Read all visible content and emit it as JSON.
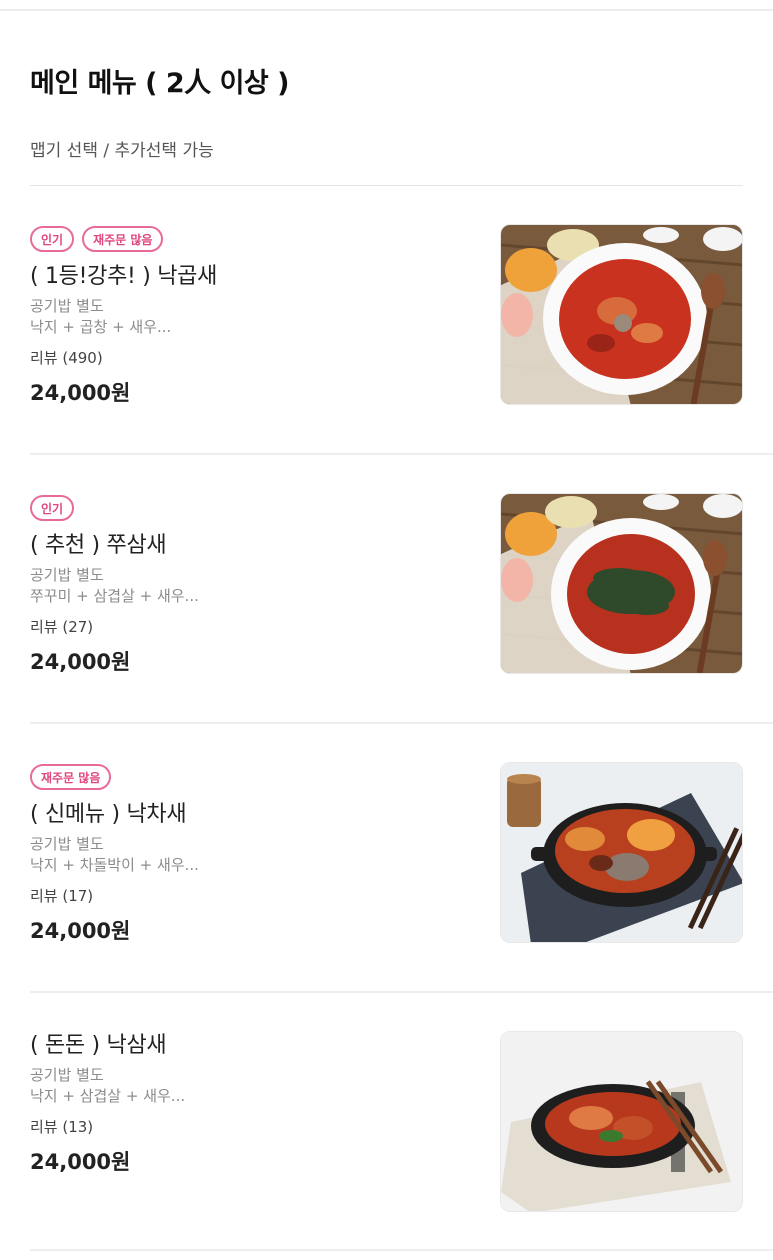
{
  "section": {
    "title": "메인 메뉴 ( 2人 이상 )",
    "subtitle": "맵기 선택 / 추가선택 가능"
  },
  "menu_items": [
    {
      "badges": [
        "인기",
        "재주문 많음"
      ],
      "name": "( 1등!강추! ) 낙곱새",
      "desc_line1": "공기밥 별도",
      "desc_line2": "낙지 + 곱창 + 새우...",
      "review": "리뷰 (490)",
      "price": "24,000원",
      "image": "nakgopsae-photo"
    },
    {
      "badges": [
        "인기"
      ],
      "name": "( 추천 ) 쭈삼새",
      "desc_line1": "공기밥 별도",
      "desc_line2": "쭈꾸미 + 삼겹살 + 새우...",
      "review": "리뷰 (27)",
      "price": "24,000원",
      "image": "jjusamsae-photo"
    },
    {
      "badges": [
        "재주문 많음"
      ],
      "name": "( 신메뉴 ) 낙차새",
      "desc_line1": "공기밥 별도",
      "desc_line2": "낙지 + 차돌박이 + 새우...",
      "review": "리뷰 (17)",
      "price": "24,000원",
      "image": "nakchasae-photo"
    },
    {
      "badges": [],
      "name": "( 돈돈 ) 낙삼새",
      "desc_line1": "공기밥 별도",
      "desc_line2": "낙지 + 삼겹살 + 새우...",
      "review": "리뷰 (13)",
      "price": "24,000원",
      "image": "naksamsae-photo"
    }
  ],
  "colors": {
    "badge_pink": "#e0467f",
    "divider": "#eeeeee",
    "sauce_red": "#c8321e"
  }
}
